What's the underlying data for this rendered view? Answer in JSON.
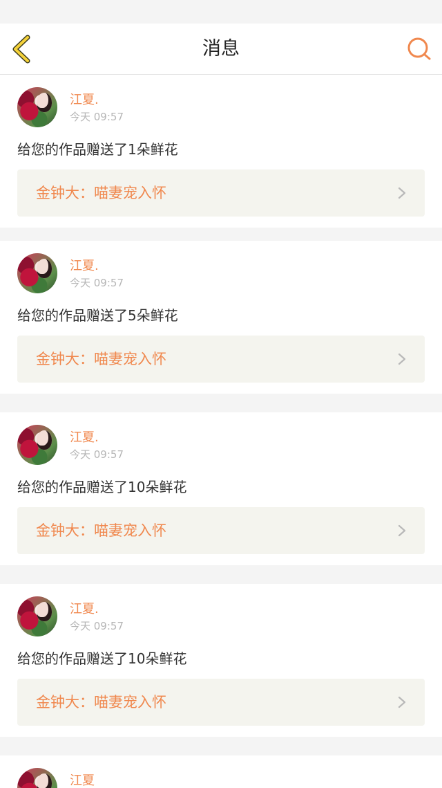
{
  "nav": {
    "title": "消息",
    "back_icon": "back-chevron-icon",
    "search_icon": "search-icon",
    "accent_color": "#f0884e",
    "back_icon_color": "#f5d23a"
  },
  "messages": [
    {
      "username": "江夏.",
      "time": "今天 09:57",
      "text": "给您的作品赠送了1朵鲜花",
      "work": "金钟大：喵妻宠入怀"
    },
    {
      "username": "江夏.",
      "time": "今天 09:57",
      "text": "给您的作品赠送了5朵鲜花",
      "work": "金钟大：喵妻宠入怀"
    },
    {
      "username": "江夏.",
      "time": "今天 09:57",
      "text": "给您的作品赠送了10朵鲜花",
      "work": "金钟大：喵妻宠入怀"
    },
    {
      "username": "江夏.",
      "time": "今天 09:57",
      "text": "给您的作品赠送了10朵鲜花",
      "work": "金钟大：喵妻宠入怀"
    },
    {
      "username": "江夏",
      "time": "",
      "text": "",
      "work": ""
    }
  ]
}
